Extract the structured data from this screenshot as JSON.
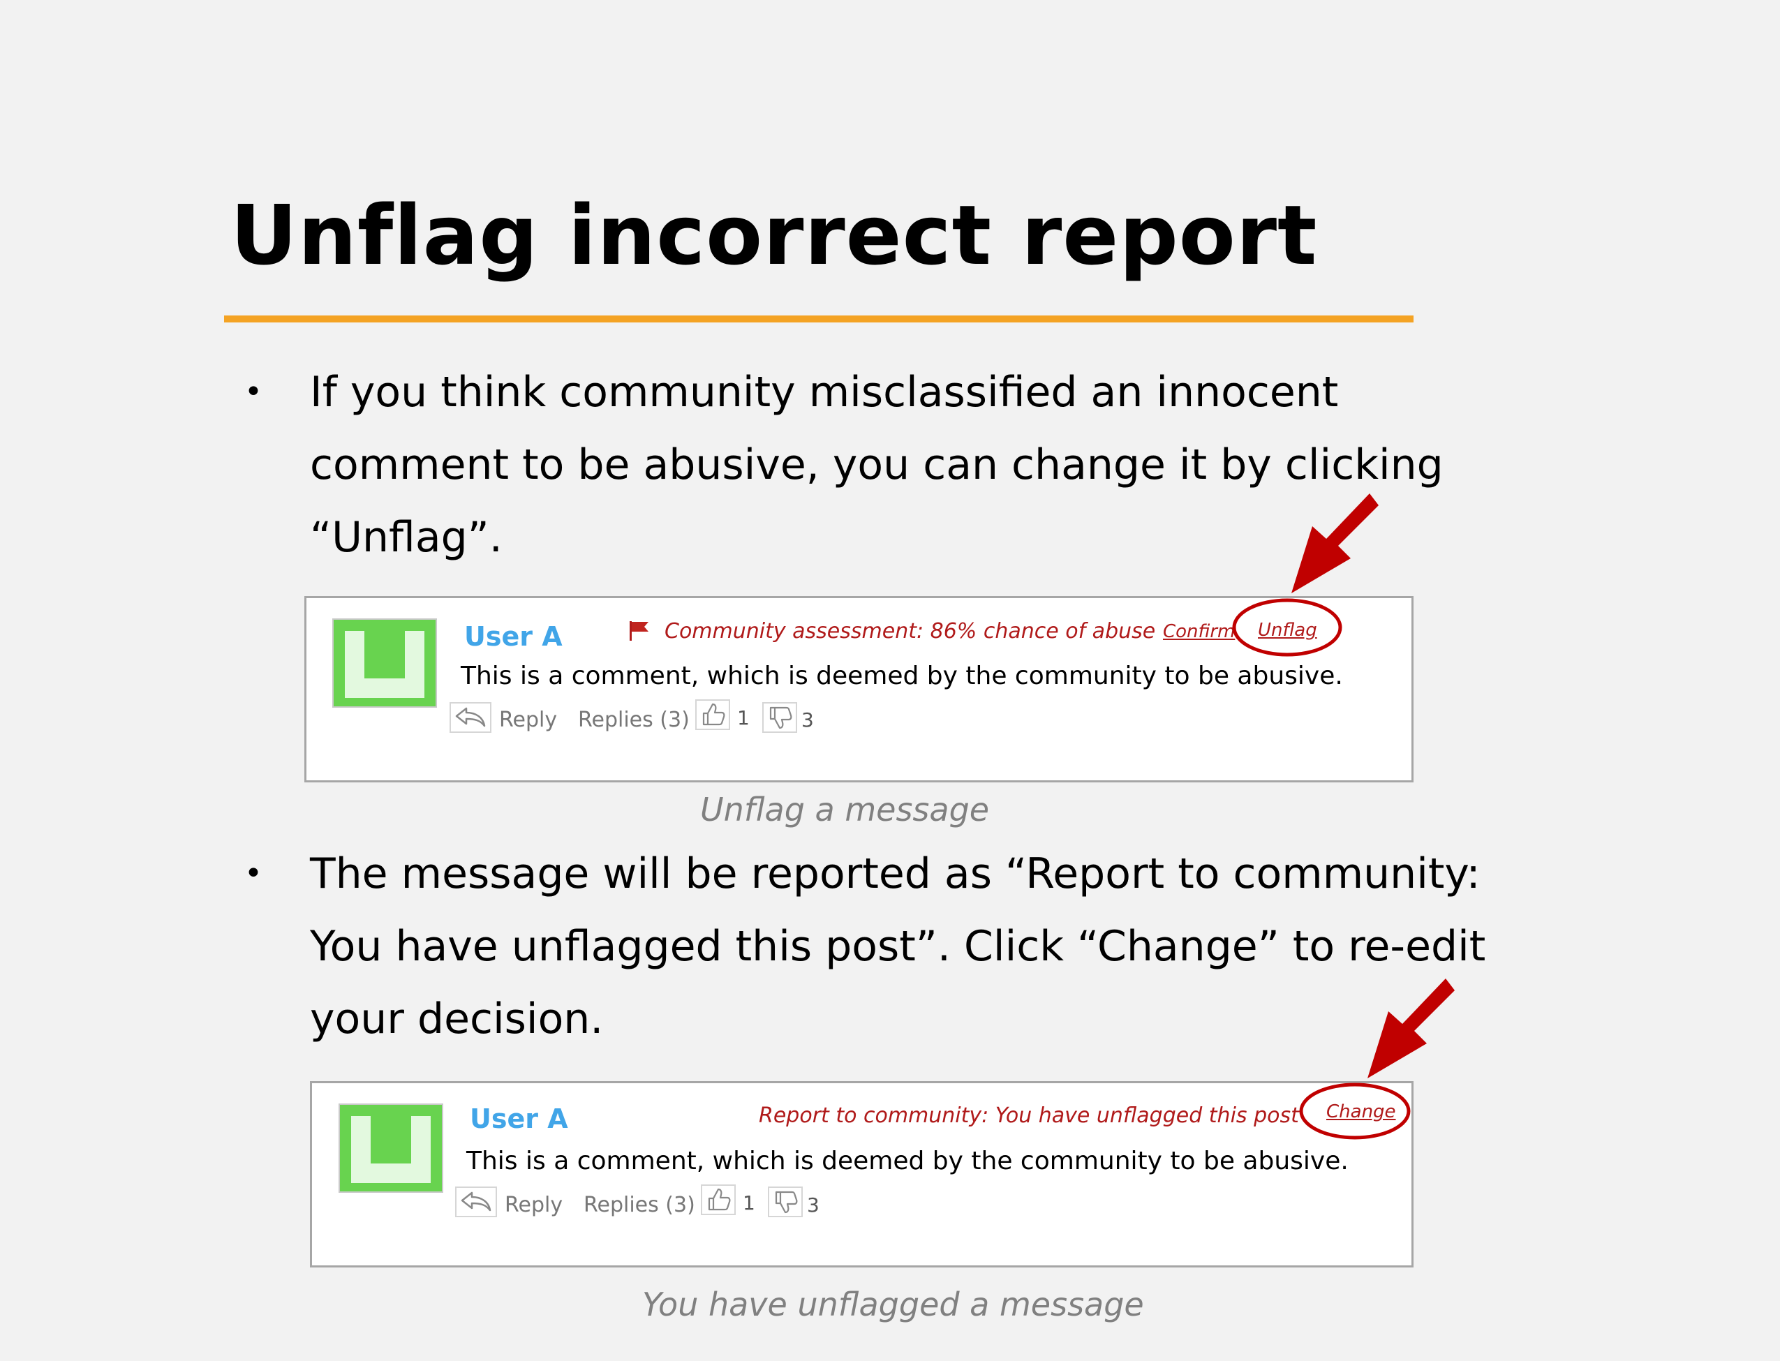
{
  "slide": {
    "title": "Unflag incorrect report",
    "colors": {
      "rule": "#f4a324",
      "username": "#41a5e8",
      "report": "#b01a1a",
      "annotation": "#c00000"
    }
  },
  "bullets": [
    {
      "marker": "•",
      "lines": [
        "If you think community misclassified an innocent",
        "comment to be abusive, you can change it by clicking",
        "“Unflag”."
      ]
    },
    {
      "marker": "•",
      "lines": [
        "The message will be reported as “Report to community:",
        "You have unflagged this post”. Click “Change” to re-edit",
        "your decision."
      ]
    }
  ],
  "card1": {
    "avatar_icon": "user-avatar-icon",
    "username": "User A",
    "flag_icon": "red-flag-icon",
    "status": "Community assessment: 86% chance of abuse",
    "confirm_label": "Confirm",
    "unflag_label": "Unflag",
    "comment": "This is a comment, which is deemed by the community to be abusive.",
    "reply_label": "Reply",
    "replies_label": "Replies (3)",
    "likes": "1",
    "dislikes": "3",
    "caption": "Unflag a message"
  },
  "card2": {
    "avatar_icon": "user-avatar-icon",
    "username": "User A",
    "status": "Report to community: You have unflagged this post",
    "change_label": "Change",
    "comment": "This is a comment, which is deemed by the community to be abusive.",
    "reply_label": "Reply",
    "replies_label": "Replies (3)",
    "likes": "1",
    "dislikes": "3",
    "caption": "You have unflagged a message"
  }
}
